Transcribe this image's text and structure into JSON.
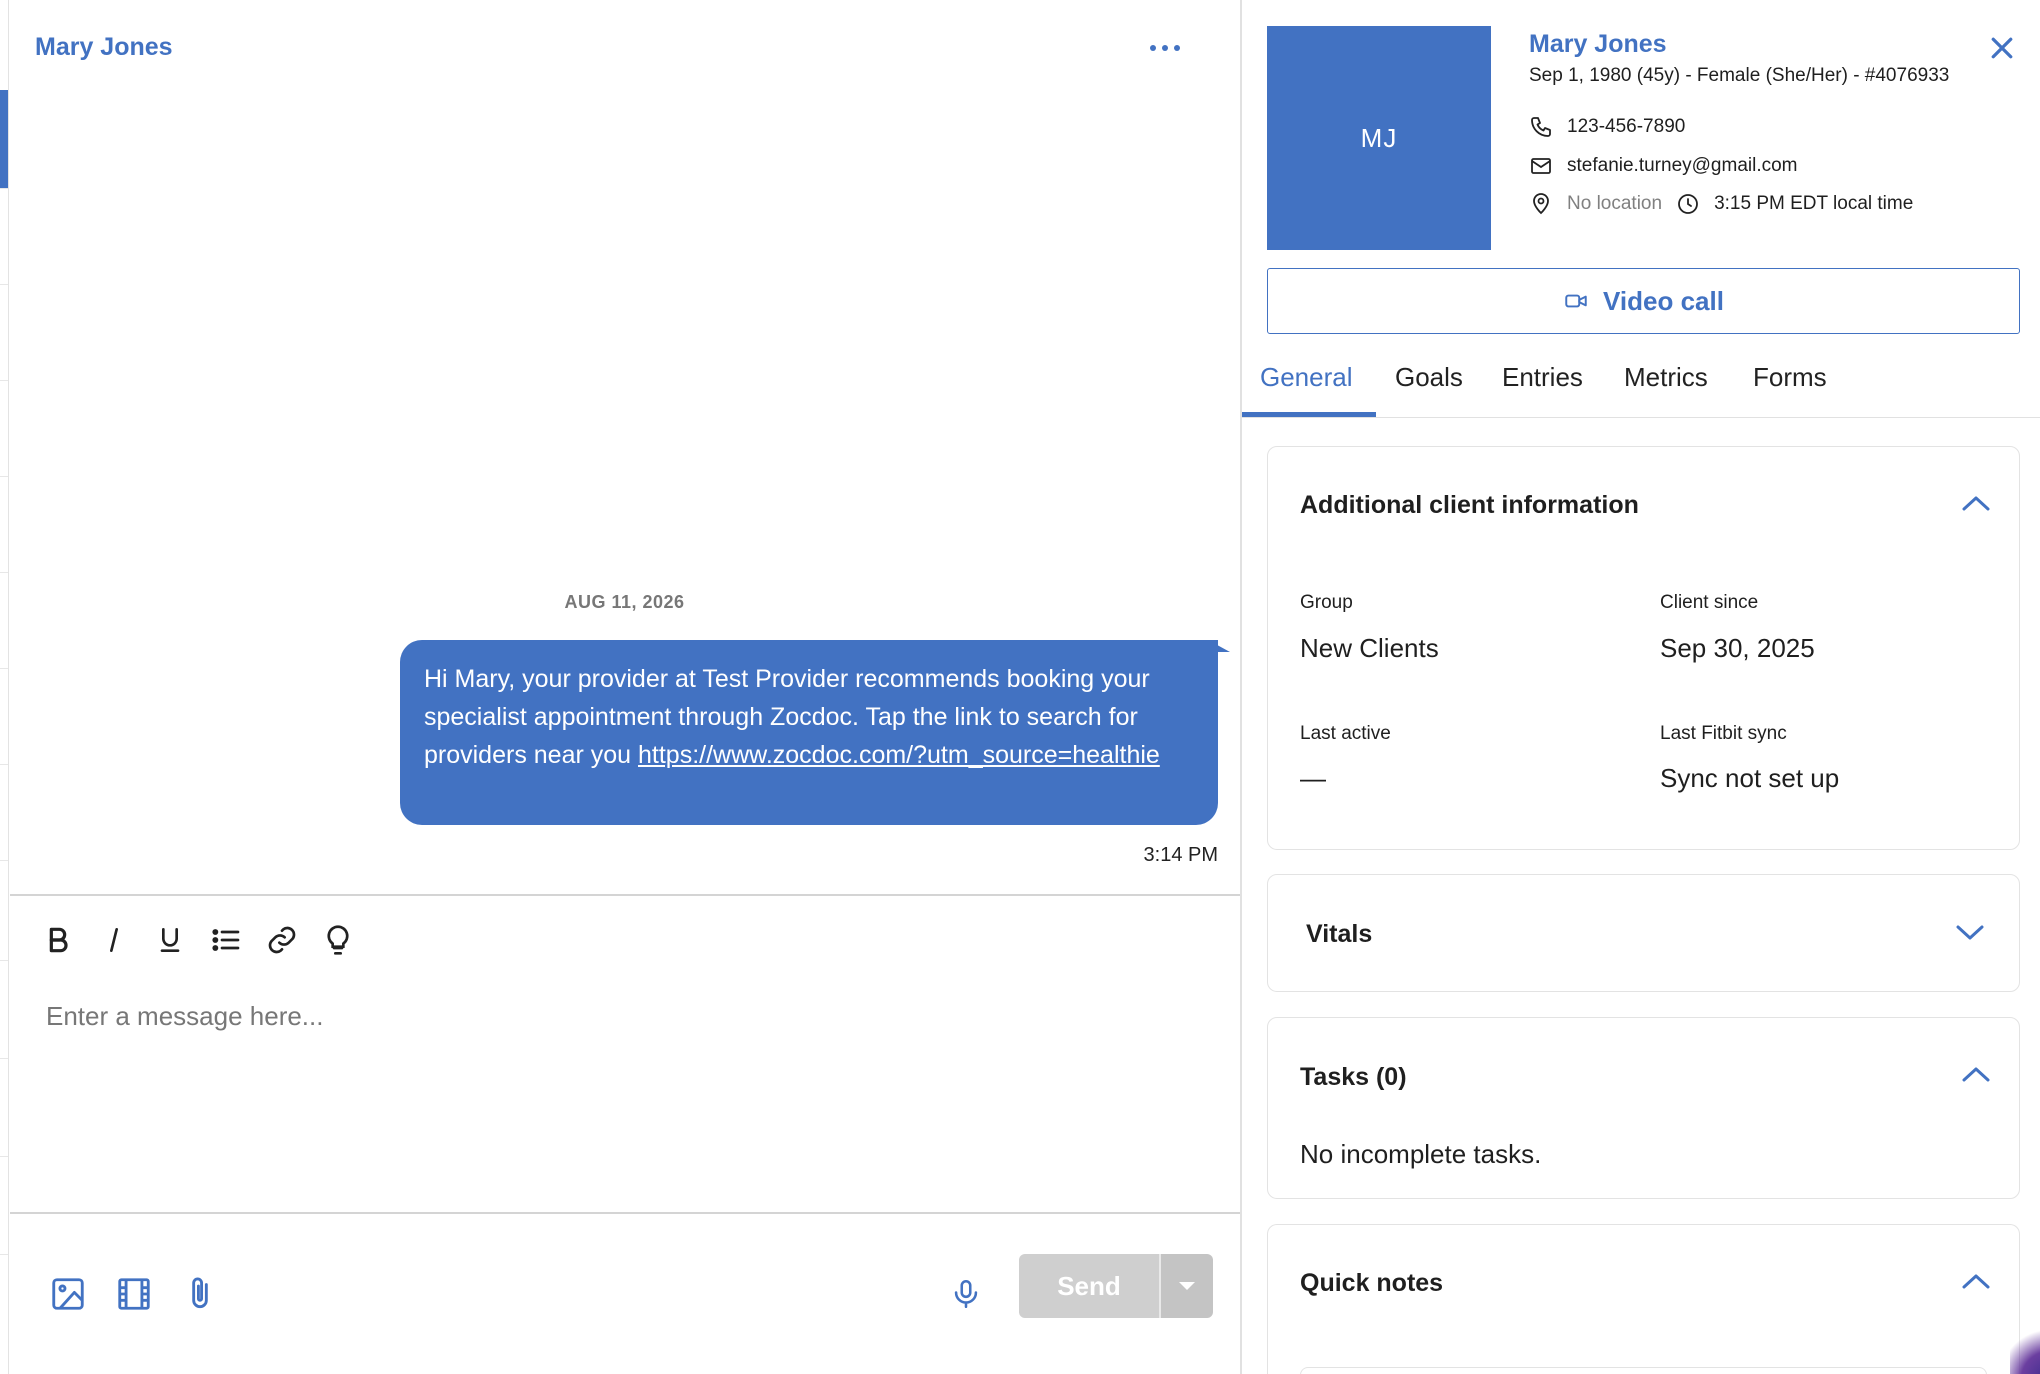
{
  "chat": {
    "header_name": "Mary Jones",
    "date_separator": "AUG 11, 2026",
    "message": {
      "text": "Hi Mary, your provider at Test Provider recommends booking your specialist appointment through Zocdoc. Tap the link to search for providers near you",
      "link": "https://www.zocdoc.com/?utm_source=healthie",
      "time": "3:14 PM"
    },
    "composer": {
      "placeholder": "Enter a message here...",
      "toolbar_icons": [
        "bold-icon",
        "italic-icon",
        "underline-icon",
        "bulleted-list-icon",
        "link-icon",
        "lightbulb-icon"
      ]
    },
    "bottom": {
      "send_label": "Send",
      "icons": [
        "image-icon",
        "film-icon",
        "paperclip-icon",
        "microphone-icon",
        "caret-down-icon"
      ]
    }
  },
  "profile": {
    "avatar_initials": "MJ",
    "name": "Mary Jones",
    "subtitle": "Sep 1, 1980 (45y) - Female (She/Her) - #4076933",
    "phone": "123-456-7890",
    "email": "stefanie.turney@gmail.com",
    "location": "No location",
    "local_time": "3:15 PM EDT local time",
    "video_call_label": "Video call",
    "tabs": [
      {
        "label": "General",
        "active": true
      },
      {
        "label": "Goals",
        "active": false
      },
      {
        "label": "Entries",
        "active": false
      },
      {
        "label": "Metrics",
        "active": false
      },
      {
        "label": "Forms",
        "active": false
      }
    ],
    "sections": {
      "additional": {
        "title": "Additional client information",
        "expanded": true,
        "fields": {
          "group_label": "Group",
          "group_value": "New Clients",
          "client_since_label": "Client since",
          "client_since_value": "Sep 30, 2025",
          "last_active_label": "Last active",
          "last_active_value": "—",
          "fitbit_label": "Last Fitbit sync",
          "fitbit_value": "Sync not set up"
        }
      },
      "vitals": {
        "title": "Vitals",
        "expanded": false
      },
      "tasks": {
        "title": "Tasks (0)",
        "expanded": true,
        "empty_text": "No incomplete tasks."
      },
      "quick_notes": {
        "title": "Quick notes",
        "expanded": true
      }
    }
  },
  "colors": {
    "accent": "#4272c2",
    "send_disabled": "#cfcfcf",
    "border": "#e3e3e3"
  }
}
